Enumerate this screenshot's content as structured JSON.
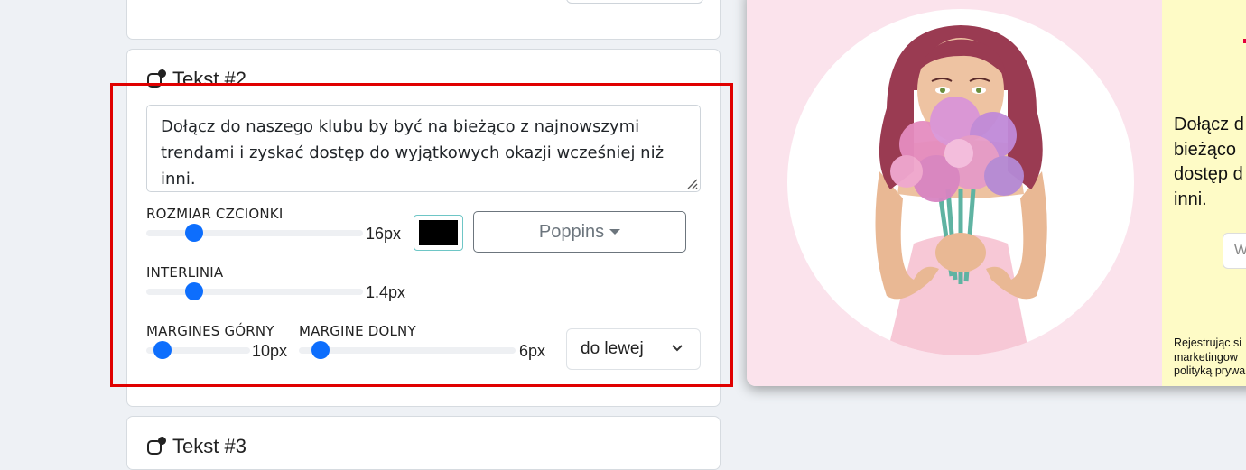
{
  "cards": {
    "main": {
      "title": "Tekst #2",
      "text": "Dołącz do naszego klubu by być na bieżąco z najnowszymi trendami i zyskać dostęp do wyjątkowych okazji wcześniej niż inni.",
      "font_size": {
        "label": "ROZMIAR CZCIONKI",
        "value": "16px",
        "fraction": 0.22
      },
      "color": "#000000",
      "font_family": "Poppins",
      "line_height": {
        "label": "INTERLINIA",
        "value": "1.4px",
        "fraction": 0.22
      },
      "margin_top": {
        "label": "MARGINES GÓRNY",
        "value": "10px",
        "fraction": 0.16
      },
      "margin_bottom": {
        "label": "MARGINE DOLNY",
        "value": "6px",
        "fraction": 0.1
      },
      "alignment": "do lewej"
    },
    "next": {
      "title": "Tekst #3"
    }
  },
  "preview": {
    "heading_lines": [
      "Dołącz d",
      "bieżąco",
      "dostęp d",
      "inni."
    ],
    "input_placeholder": "W",
    "legal_lines": [
      "Rejestrując si",
      "marketingow",
      "polityką prywa"
    ],
    "left_bg": "#fbe3ec",
    "right_bg": "#fefbc6"
  },
  "highlight_color": "#e00000",
  "accent": "#0d6efd"
}
